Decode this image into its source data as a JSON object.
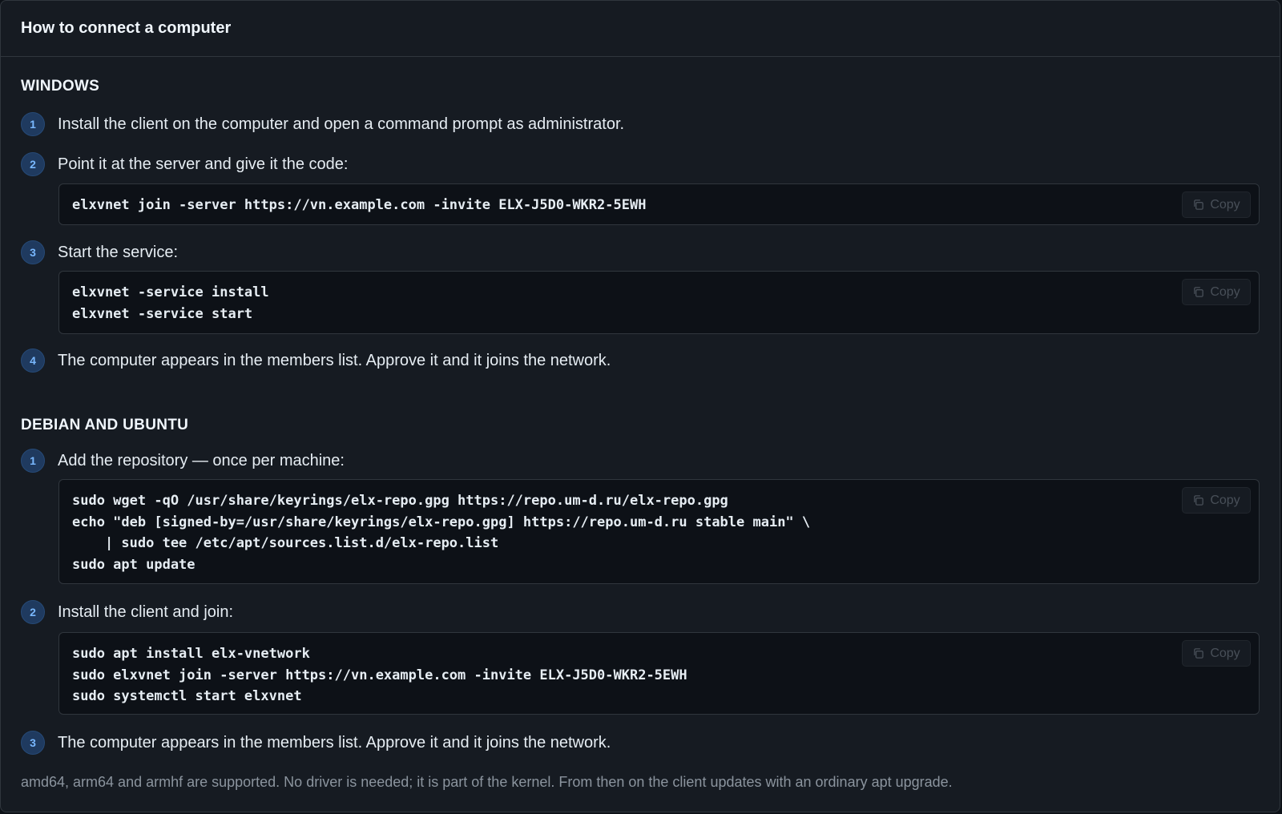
{
  "header": {
    "title": "How to connect a computer"
  },
  "windows": {
    "heading": "WINDOWS",
    "steps": [
      {
        "number": "1",
        "text": "Install the client on the computer and open a command prompt as administrator."
      },
      {
        "number": "2",
        "text": "Point it at the server and give it the code:"
      },
      {
        "number": "3",
        "text": "Start the service:"
      },
      {
        "number": "4",
        "text": "The computer appears in the members list. Approve it and it joins the network."
      }
    ],
    "code_join": [
      "elxvnet join -server https://vn.example.com -invite ELX-J5D0-WKR2-5EWH"
    ],
    "code_service": [
      "elxvnet -service install",
      "elxvnet -service start"
    ]
  },
  "debian": {
    "heading": "DEBIAN AND UBUNTU",
    "steps": [
      {
        "number": "1",
        "text": "Add the repository — once per machine:"
      },
      {
        "number": "2",
        "text": "Install the client and join:"
      },
      {
        "number": "3",
        "text": "The computer appears in the members list. Approve it and it joins the network."
      }
    ],
    "code_repo": [
      "sudo wget -qO /usr/share/keyrings/elx-repo.gpg https://repo.um-d.ru/elx-repo.gpg",
      "echo \"deb [signed-by=/usr/share/keyrings/elx-repo.gpg] https://repo.um-d.ru stable main\" \\",
      "    | sudo tee /etc/apt/sources.list.d/elx-repo.list",
      "sudo apt update"
    ],
    "code_install": [
      "sudo apt install elx-vnetwork",
      "sudo elxvnet join -server https://vn.example.com -invite ELX-J5D0-WKR2-5EWH",
      "sudo systemctl start elxvnet"
    ]
  },
  "copy_label": "Copy",
  "footnote": "amd64, arm64 and armhf are supported. No driver is needed; it is part of the kernel. From then on the client updates with an ordinary apt upgrade.",
  "icons": {
    "copy": "copy-icon"
  },
  "colors": {
    "panel_bg": "#161b22",
    "code_bg": "#0d1117",
    "badge_bg": "#1f3a5f",
    "badge_text": "#79b8ff",
    "muted_text": "#8b949e"
  }
}
